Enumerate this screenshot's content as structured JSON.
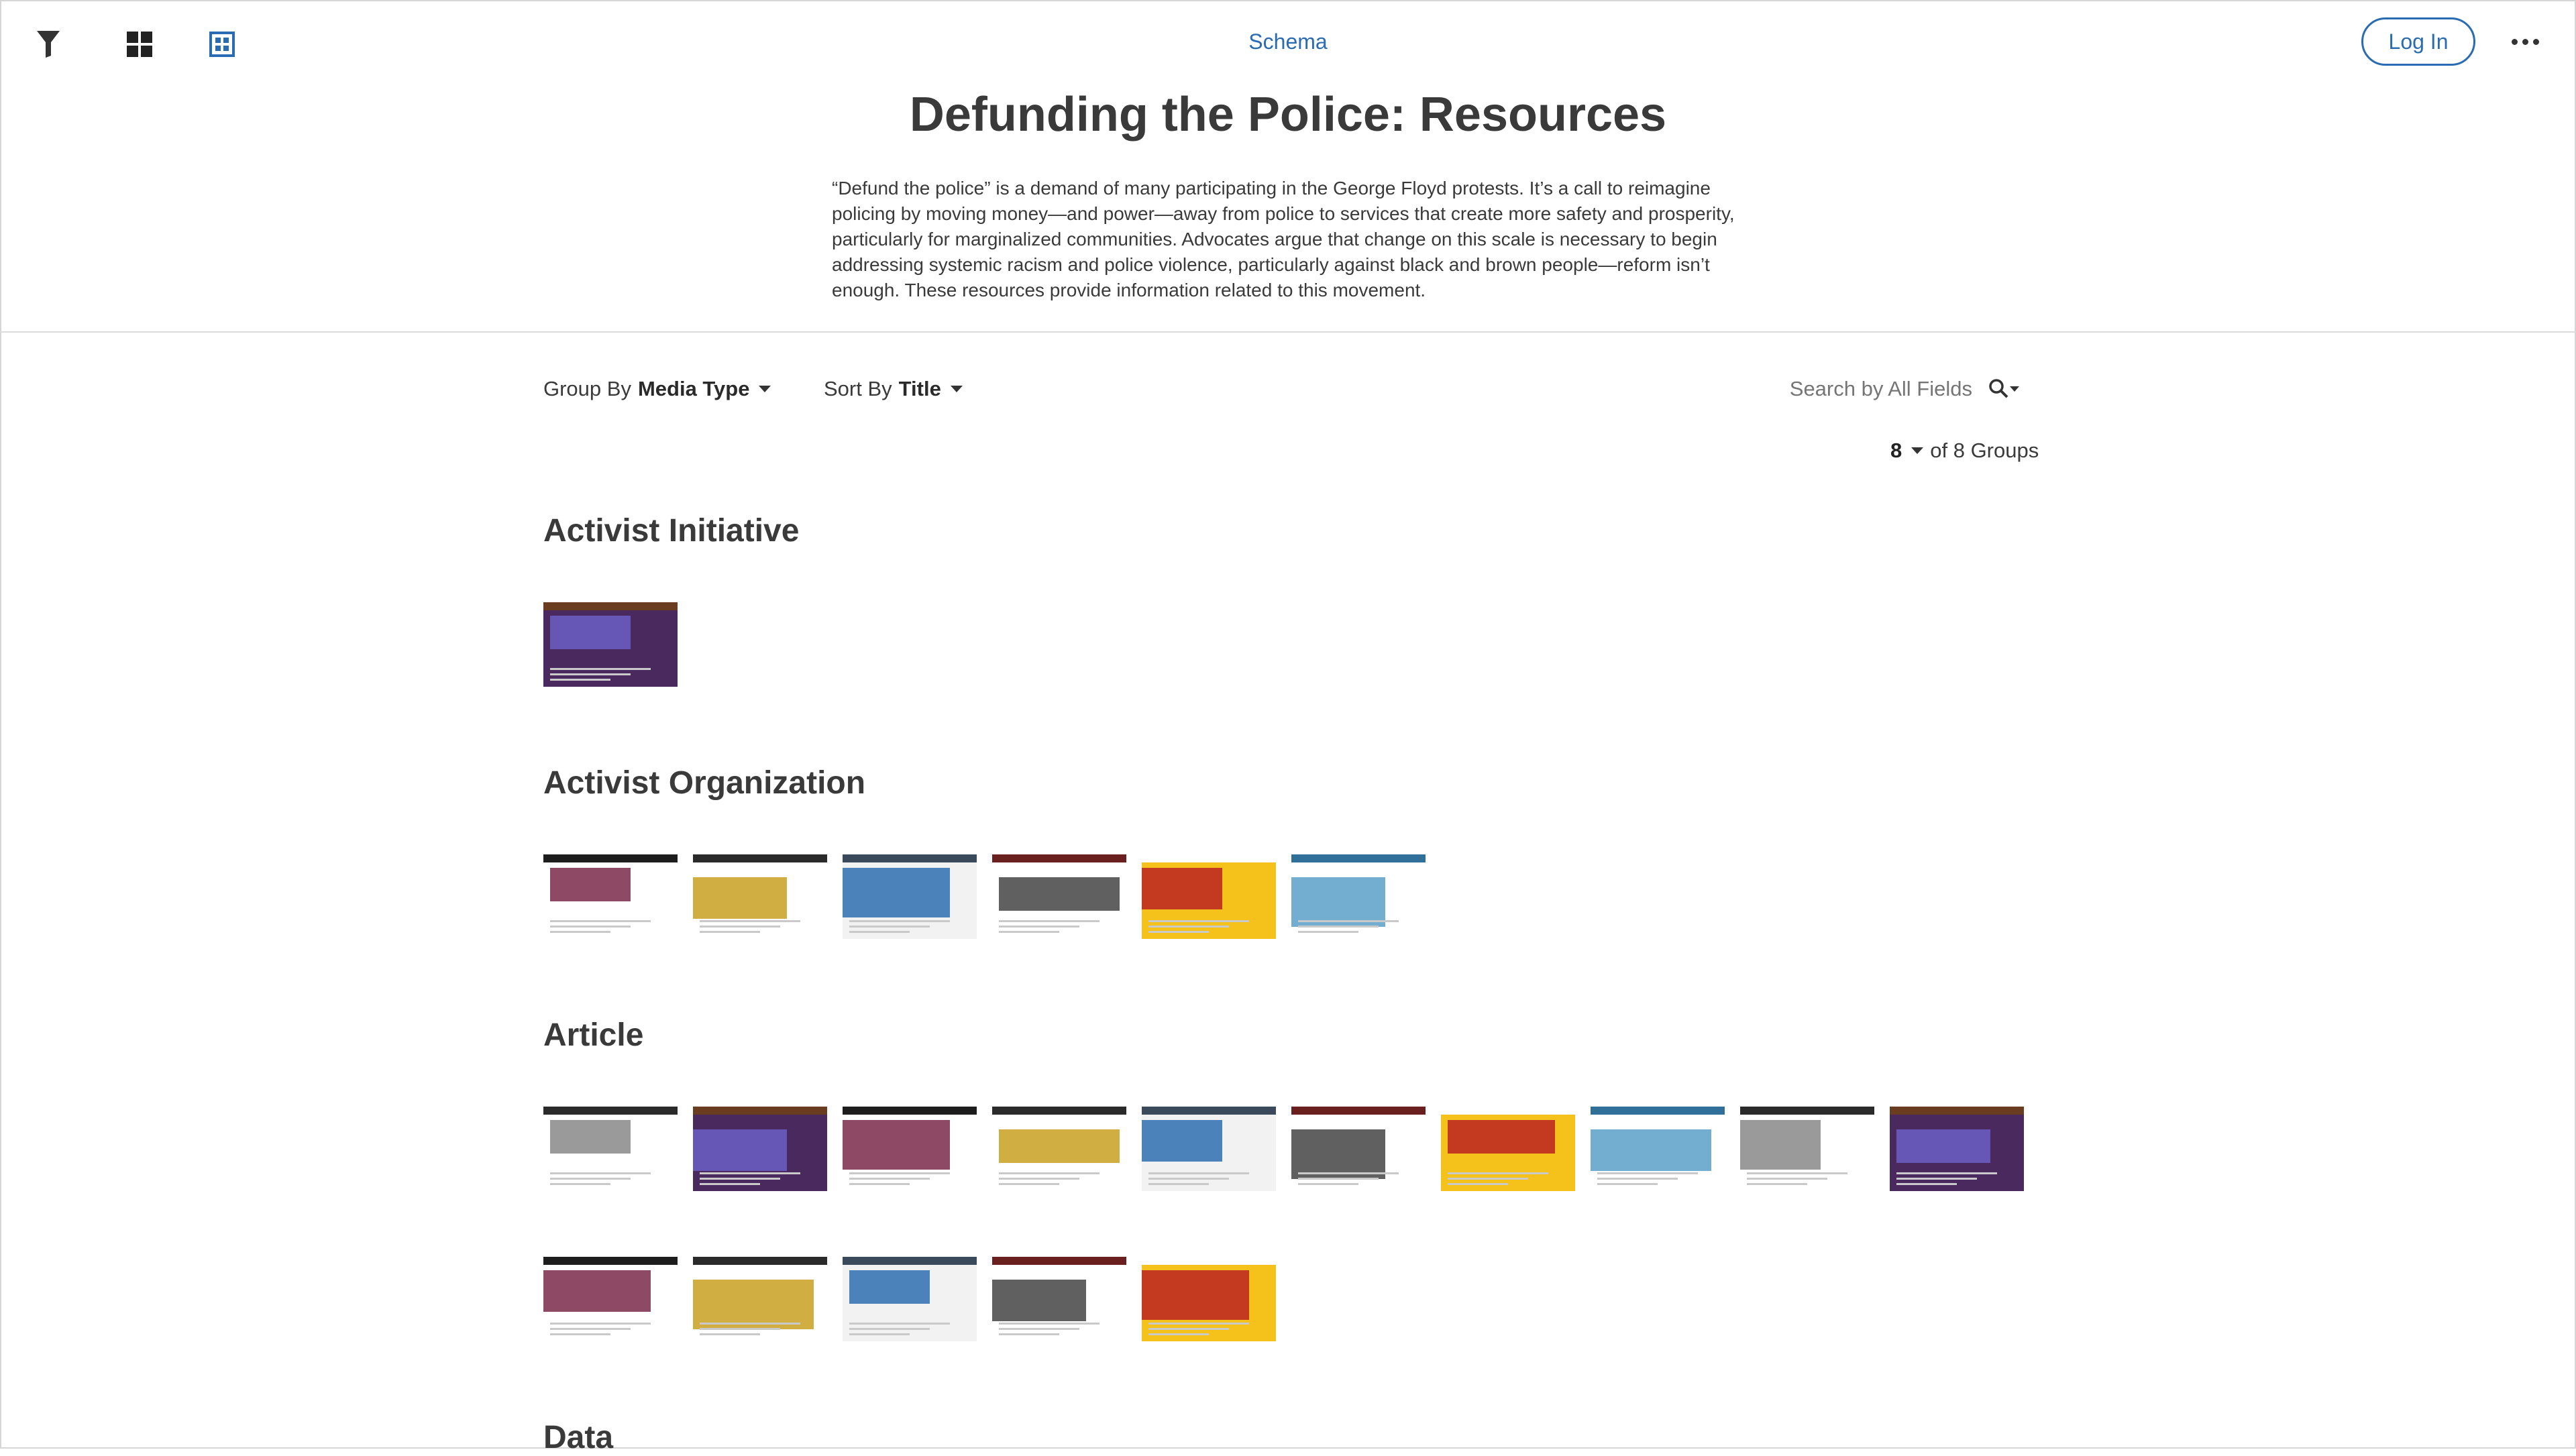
{
  "topbar": {
    "filter_icon": "filter-funnel-icon",
    "grid_icon": "grid-view-icon",
    "gallery_icon": "gallery-view-icon",
    "schema_label": "Schema",
    "login_label": "Log In",
    "more_icon": "more-dots-icon"
  },
  "page": {
    "title": "Defunding the Police: Resources",
    "description": "“Defund the police” is a demand of many participating in the George Floyd protests. It’s a call to reimagine policing by moving money—and power—away from police to services that create more safety and prosperity, particularly for marginalized communities. Advocates argue that change on this scale is necessary to begin addressing systemic racism and police violence, particularly against black and brown people—reform isn’t enough. These resources provide information related to this movement."
  },
  "controls": {
    "group_by_prefix": "Group By",
    "group_by_value": "Media Type",
    "sort_by_prefix": "Sort By",
    "sort_by_value": "Title",
    "search_placeholder": "Search by All Fields",
    "groups_shown": "8",
    "groups_total_text": "of 8 Groups"
  },
  "groups": [
    {
      "title": "Activist Initiative",
      "item_count": 1
    },
    {
      "title": "Activist Organization",
      "item_count": 6
    },
    {
      "title": "Article",
      "item_count": 15
    },
    {
      "title": "Data",
      "item_count": 0
    }
  ],
  "colors": {
    "accent": "#2a6cb3",
    "text": "#3a3a3a",
    "divider": "#dcdcdc"
  }
}
